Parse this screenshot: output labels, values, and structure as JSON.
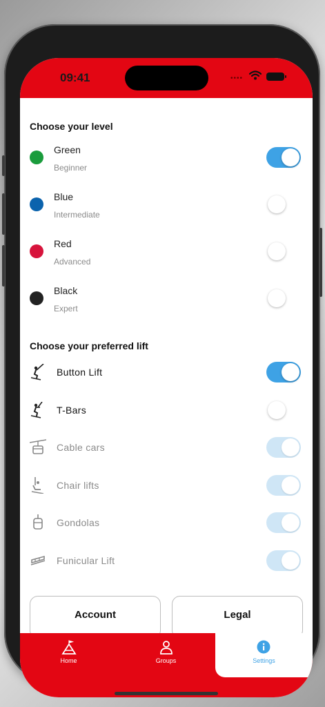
{
  "status": {
    "time": "09:41"
  },
  "colors": {
    "brand": "#e30613",
    "toggle_on": "#3ea2e5",
    "toggle_disabled": "#cfe6f6",
    "green": "#1a9c3c",
    "blue": "#0b63ad",
    "red": "#d7143c",
    "black": "#222222"
  },
  "levels": {
    "title": "Choose your level",
    "items": [
      {
        "name": "Green",
        "desc": "Beginner",
        "color": "#1a9c3c",
        "enabled": true
      },
      {
        "name": "Blue",
        "desc": "Intermediate",
        "color": "#0b63ad",
        "enabled": false
      },
      {
        "name": "Red",
        "desc": "Advanced",
        "color": "#d7143c",
        "enabled": false
      },
      {
        "name": "Black",
        "desc": "Expert",
        "color": "#222222",
        "enabled": false
      }
    ]
  },
  "lifts": {
    "title": "Choose your preferred lift",
    "items": [
      {
        "name": "Button Lift",
        "icon": "button-lift-icon",
        "enabled": true,
        "disabled": false
      },
      {
        "name": "T-Bars",
        "icon": "t-bar-icon",
        "enabled": false,
        "disabled": false
      },
      {
        "name": "Cable cars",
        "icon": "cable-car-icon",
        "enabled": true,
        "disabled": true
      },
      {
        "name": "Chair lifts",
        "icon": "chair-lift-icon",
        "enabled": true,
        "disabled": true
      },
      {
        "name": "Gondolas",
        "icon": "gondola-icon",
        "enabled": true,
        "disabled": true
      },
      {
        "name": "Funicular Lift",
        "icon": "funicular-icon",
        "enabled": true,
        "disabled": true
      }
    ]
  },
  "buttons": {
    "account": "Account",
    "legal": "Legal"
  },
  "tabs": [
    {
      "label": "Home",
      "icon": "mountain-flag-icon",
      "active": false
    },
    {
      "label": "Groups",
      "icon": "person-icon",
      "active": false
    },
    {
      "label": "Settings",
      "icon": "info-icon",
      "active": true
    }
  ]
}
